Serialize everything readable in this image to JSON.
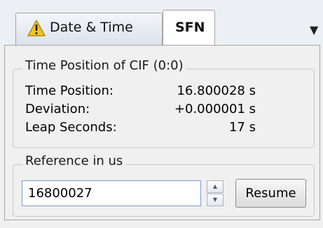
{
  "tabs": [
    {
      "label": "Date & Time",
      "icon": "warning-icon",
      "active": false
    },
    {
      "label": "SFN",
      "active": true
    }
  ],
  "cif_group": {
    "title": "Time Position of CIF (0:0)",
    "rows": [
      {
        "label": "Time Position:",
        "value": "16.800028 s"
      },
      {
        "label": "Deviation:",
        "value": "+0.000001 s"
      },
      {
        "label": "Leap Seconds:",
        "value": "17 s"
      }
    ]
  },
  "reference_group": {
    "title": "Reference in us",
    "value": "16800027",
    "resume_label": "Resume"
  },
  "colors": {
    "warning_fill": "#f5c518",
    "tab_border": "#a3a3a3",
    "input_border": "#7a9cd3"
  }
}
